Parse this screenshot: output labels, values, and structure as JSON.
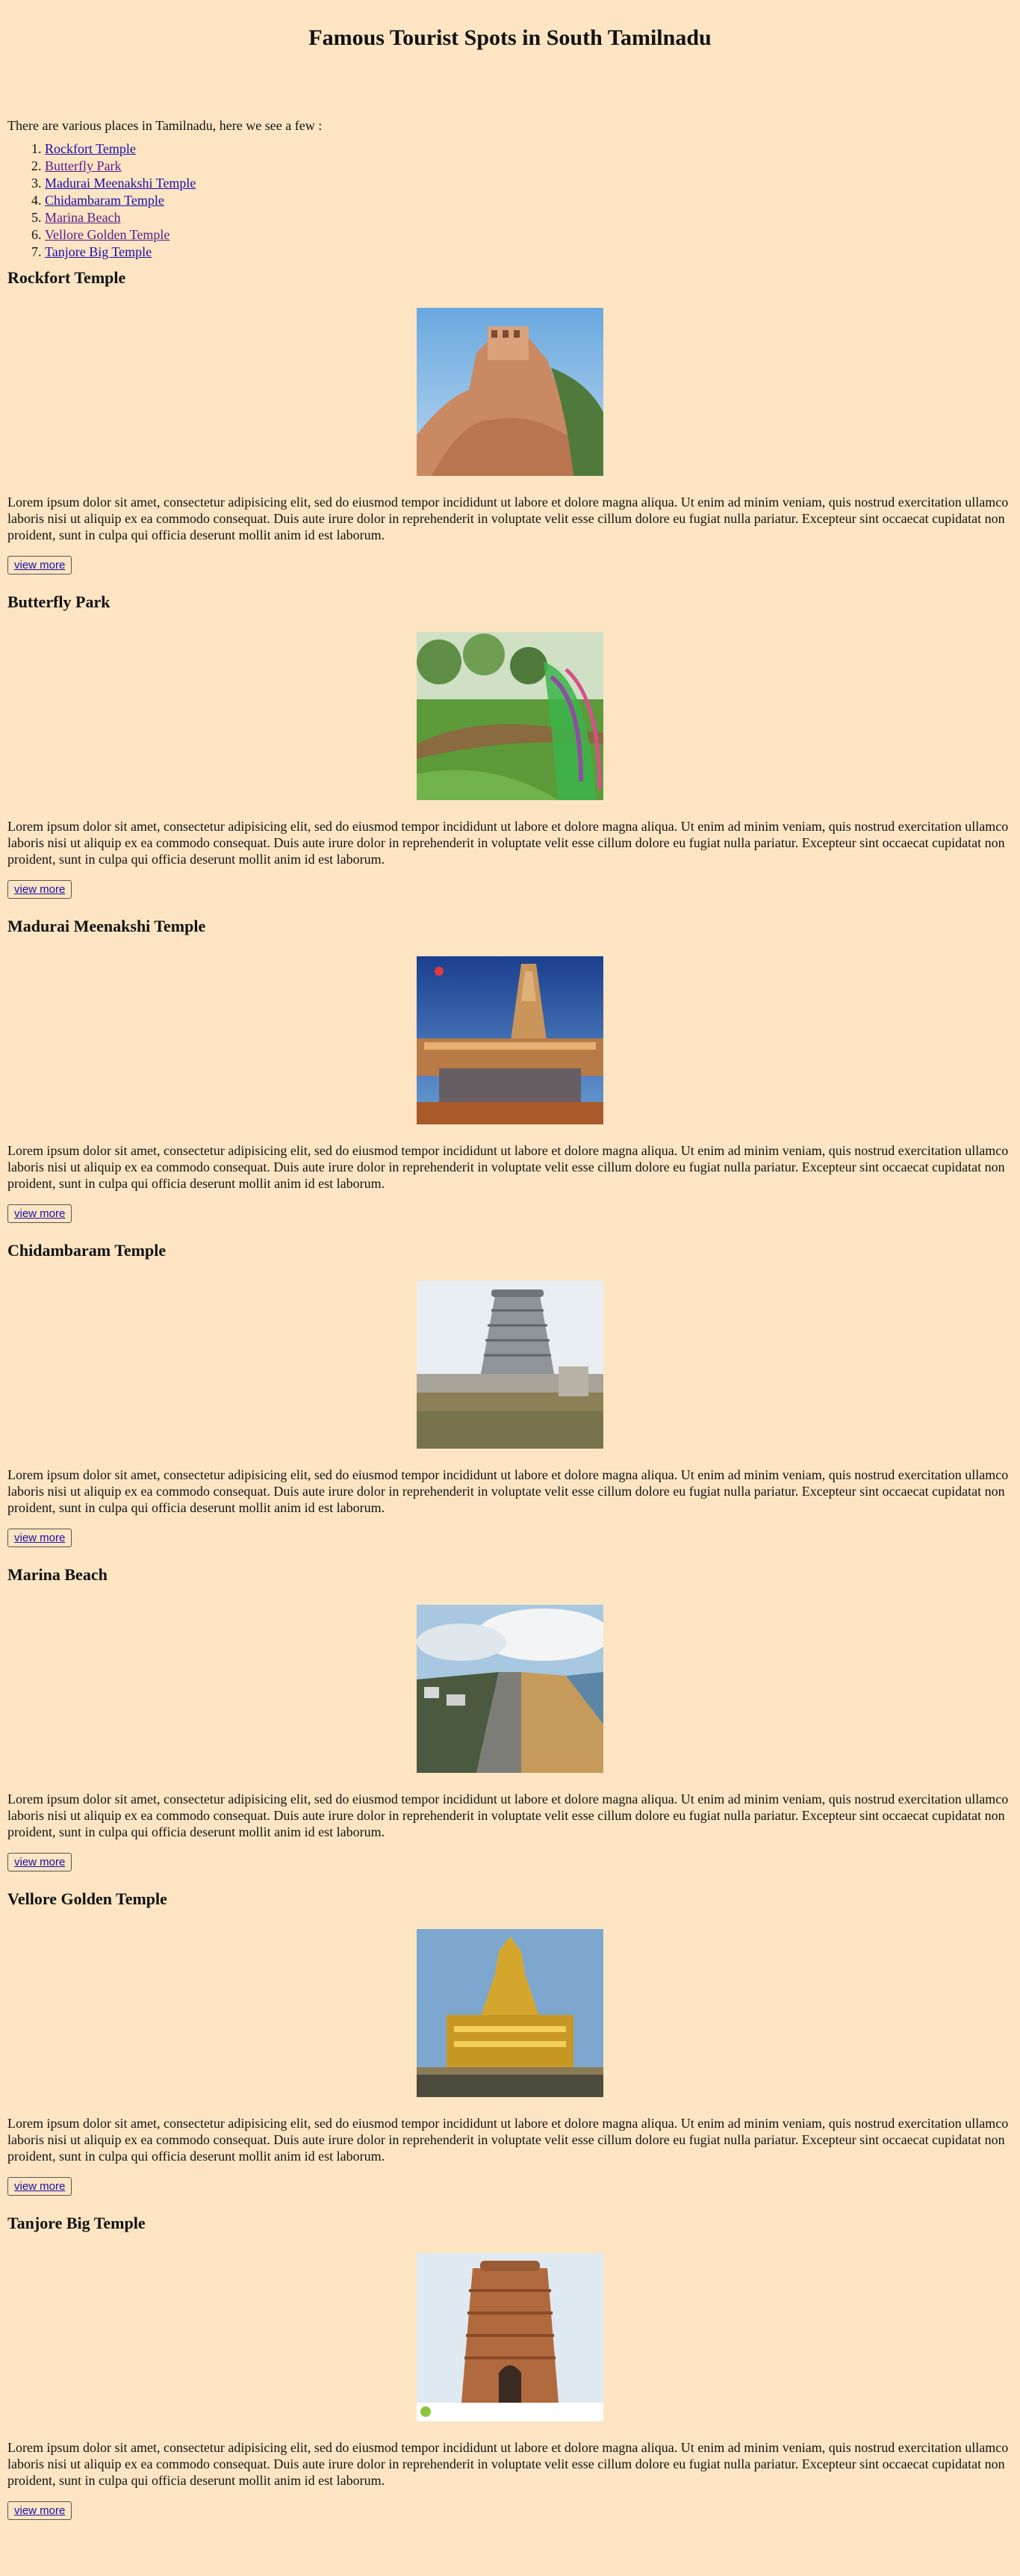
{
  "page": {
    "title": "Famous Tourist Spots in South Tamilnadu",
    "intro": "There are various places in Tamilnadu, here we see a few :"
  },
  "toc": [
    {
      "label": "Rockfort Temple",
      "visited": false
    },
    {
      "label": "Butterfly Park",
      "visited": true
    },
    {
      "label": "Madurai Meenakshi Temple",
      "visited": false
    },
    {
      "label": "Chidambaram Temple",
      "visited": false
    },
    {
      "label": "Marina Beach",
      "visited": true
    },
    {
      "label": "Vellore Golden Temple",
      "visited": true
    },
    {
      "label": "Tanjore Big Temple",
      "visited": false
    }
  ],
  "spots": [
    {
      "heading": "Rockfort Temple",
      "image": "rockfort-photo",
      "text": "Lorem ipsum dolor sit amet, consectetur adipisicing elit, sed do eiusmod tempor incididunt ut labore et dolore magna aliqua. Ut enim ad minim veniam, quis nostrud exercitation ullamco laboris nisi ut aliquip ex ea commodo consequat. Duis aute irure dolor in reprehenderit in voluptate velit esse cillum dolore eu fugiat nulla pariatur. Excepteur sint occaecat cupidatat non proident, sunt in culpa qui officia deserunt mollit anim id est laborum.",
      "button": "view more"
    },
    {
      "heading": "Butterfly Park",
      "image": "butterfly-park-photo",
      "text": "Lorem ipsum dolor sit amet, consectetur adipisicing elit, sed do eiusmod tempor incididunt ut labore et dolore magna aliqua. Ut enim ad minim veniam, quis nostrud exercitation ullamco laboris nisi ut aliquip ex ea commodo consequat. Duis aute irure dolor in reprehenderit in voluptate velit esse cillum dolore eu fugiat nulla pariatur. Excepteur sint occaecat cupidatat non proident, sunt in culpa qui officia deserunt mollit anim id est laborum.",
      "button": "view more"
    },
    {
      "heading": "Madurai Meenakshi Temple",
      "image": "meenakshi-temple-photo",
      "text": "Lorem ipsum dolor sit amet, consectetur adipisicing elit, sed do eiusmod tempor incididunt ut labore et dolore magna aliqua. Ut enim ad minim veniam, quis nostrud exercitation ullamco laboris nisi ut aliquip ex ea commodo consequat. Duis aute irure dolor in reprehenderit in voluptate velit esse cillum dolore eu fugiat nulla pariatur. Excepteur sint occaecat cupidatat non proident, sunt in culpa qui officia deserunt mollit anim id est laborum.",
      "button": "view more"
    },
    {
      "heading": "Chidambaram Temple",
      "image": "chidambaram-temple-photo",
      "text": "Lorem ipsum dolor sit amet, consectetur adipisicing elit, sed do eiusmod tempor incididunt ut labore et dolore magna aliqua. Ut enim ad minim veniam, quis nostrud exercitation ullamco laboris nisi ut aliquip ex ea commodo consequat. Duis aute irure dolor in reprehenderit in voluptate velit esse cillum dolore eu fugiat nulla pariatur. Excepteur sint occaecat cupidatat non proident, sunt in culpa qui officia deserunt mollit anim id est laborum.",
      "button": "view more"
    },
    {
      "heading": "Marina Beach",
      "image": "marina-beach-photo",
      "text": "Lorem ipsum dolor sit amet, consectetur adipisicing elit, sed do eiusmod tempor incididunt ut labore et dolore magna aliqua. Ut enim ad minim veniam, quis nostrud exercitation ullamco laboris nisi ut aliquip ex ea commodo consequat. Duis aute irure dolor in reprehenderit in voluptate velit esse cillum dolore eu fugiat nulla pariatur. Excepteur sint occaecat cupidatat non proident, sunt in culpa qui officia deserunt mollit anim id est laborum.",
      "button": "view more"
    },
    {
      "heading": "Vellore Golden Temple",
      "image": "golden-temple-photo",
      "text": "Lorem ipsum dolor sit amet, consectetur adipisicing elit, sed do eiusmod tempor incididunt ut labore et dolore magna aliqua. Ut enim ad minim veniam, quis nostrud exercitation ullamco laboris nisi ut aliquip ex ea commodo consequat. Duis aute irure dolor in reprehenderit in voluptate velit esse cillum dolore eu fugiat nulla pariatur. Excepteur sint occaecat cupidatat non proident, sunt in culpa qui officia deserunt mollit anim id est laborum.",
      "button": "view more"
    },
    {
      "heading": "Tanjore Big Temple",
      "image": "big-temple-photo",
      "text": "Lorem ipsum dolor sit amet, consectetur adipisicing elit, sed do eiusmod tempor incididunt ut labore et dolore magna aliqua. Ut enim ad minim veniam, quis nostrud exercitation ullamco laboris nisi ut aliquip ex ea commodo consequat. Duis aute irure dolor in reprehenderit in voluptate velit esse cillum dolore eu fugiat nulla pariatur. Excepteur sint occaecat cupidatat non proident, sunt in culpa qui officia deserunt mollit anim id est laborum.",
      "button": "view more"
    }
  ],
  "colors": {
    "background": "#fde5c3",
    "link": "#1a0dab",
    "visited_link": "#551a8b"
  }
}
